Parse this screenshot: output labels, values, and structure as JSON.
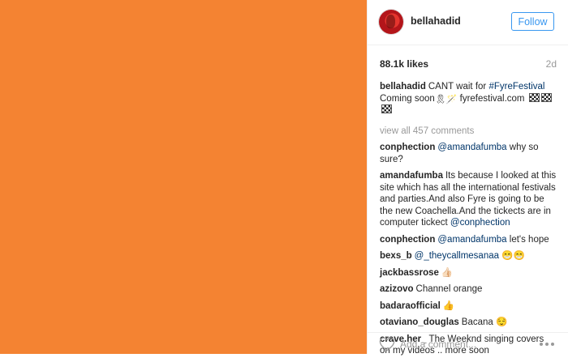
{
  "post": {
    "media_color": "#f48332",
    "author": "bellahadid",
    "follow_label": "Follow",
    "likes": "88.1k likes",
    "age": "2d",
    "caption": {
      "user": "bellahadid",
      "text_before": "CANT wait for ",
      "hashtag": "#FyreFestival",
      "text_after": " Coming soon",
      "site": " fyrefestival.com "
    },
    "view_all": "view all 457 comments",
    "comments": [
      {
        "user": "conphection",
        "mention": "@amandafumba",
        "text": " why so sure?"
      },
      {
        "user": "amandafumba",
        "text": "Its because I looked at this site which has all the international festivals and parties.And also Fyre is going to be the new Coachella.And the tickects are in computer tickect ",
        "mention_end": "@conphection"
      },
      {
        "user": "conphection",
        "mention": "@amandafumba",
        "text": " let's hope"
      },
      {
        "user": "bexs_b",
        "mention": "@_theycallmesanaa",
        "text": " 😁😁"
      },
      {
        "user": "jackbassrose",
        "text": "👍🏻"
      },
      {
        "user": "azizovo",
        "text": "Channel orange"
      },
      {
        "user": "badaraofficial",
        "text": "👍"
      },
      {
        "user": "otaviano_douglas",
        "text": "Bacana 😌"
      },
      {
        "user": "crave.her_",
        "text": "The Weeknd singing covers on my videos .. more soon"
      }
    ],
    "add_comment_placeholder": "Add a comment...",
    "icons": {
      "like": "heart-icon",
      "more": "more-options-icon",
      "link_emoji": "ribbon-icon"
    }
  }
}
